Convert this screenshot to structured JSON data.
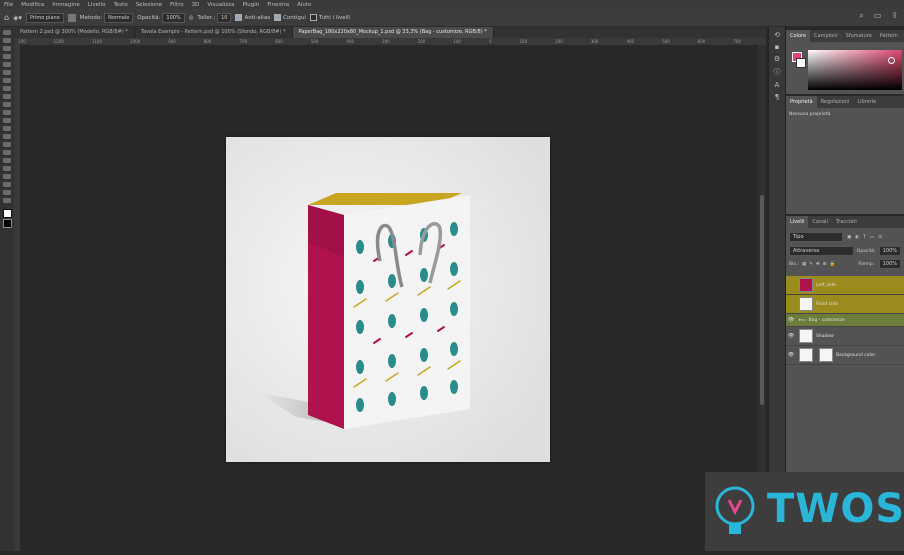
{
  "menu": [
    "File",
    "Modifica",
    "Immagine",
    "Livello",
    "Testo",
    "Selezione",
    "Filtro",
    "3D",
    "Visualizza",
    "Plugin",
    "Finestra",
    "Aiuto"
  ],
  "options": {
    "mode_select": "Primo piano",
    "metodo_label": "Metodo:",
    "metodo_value": "Normale",
    "opacita_label": "Opacità:",
    "opacita_value": "100%",
    "tolleranza_label": "Toller.:",
    "tolleranza_value": "10",
    "antialias": "Anti-alias",
    "contigui": "Contigui",
    "tutti_livelli": "Tutti i livelli"
  },
  "tabs": [
    {
      "label": "Pattern 2.psd @ 300% (Modello, RGB/8#) *",
      "active": false
    },
    {
      "label": "Tavola Esempio - Pattern.psd @ 100% (Sfondo, RGB/8#) *",
      "active": false
    },
    {
      "label": "PaperBag_180x220x80_Mockup_1.psd @ 33,3% (Bag - customize, RGB/8) *",
      "active": true
    }
  ],
  "ruler_ticks": [
    "100",
    "1200",
    "1100",
    "1000",
    "900",
    "800",
    "700",
    "600",
    "500",
    "400",
    "300",
    "200",
    "100",
    "0",
    "100",
    "200",
    "300",
    "400",
    "500",
    "600",
    "700",
    "800",
    "900",
    "1000",
    "1100",
    "1200",
    "1300",
    "1400",
    "1500",
    "1600",
    "1700",
    "1800",
    "1900",
    "2000",
    "2100",
    "2200",
    "2300"
  ],
  "color_panel": {
    "tabs": [
      "Colore",
      "Campioni",
      "Sfumature",
      "Pattern"
    ],
    "foreground": "#e0466f"
  },
  "properties_panel": {
    "tabs": [
      "Proprietà",
      "Regolazioni",
      "Librerie"
    ],
    "content": "Nessuna proprietà"
  },
  "layers_panel": {
    "tabs": [
      "Livelli",
      "Canali",
      "Tracciati"
    ],
    "filter": "Tipo",
    "blend_mode": "Attraversa",
    "opacity_label": "Opacità:",
    "opacity_value": "100%",
    "lock_label": "Blo.:",
    "fill_label": "Riemp.:",
    "fill_value": "100%",
    "layers": [
      {
        "name": "Left_side",
        "color": "#9b8a1c",
        "visible": false
      },
      {
        "name": "Front side",
        "color": "#9b8a1c",
        "visible": false
      },
      {
        "name": "Bag - customize",
        "color": "#6b7d3a",
        "visible": true,
        "group": true
      },
      {
        "name": "Shadow",
        "color": "#535353",
        "visible": true
      },
      {
        "name": "Background color",
        "color": "#535353",
        "visible": true
      }
    ]
  },
  "watermark": {
    "text": "TWOS"
  },
  "colors": {
    "bag_side": "#b0124e",
    "bag_inside": "#c8a520",
    "pattern_teal": "#2a8c8c"
  }
}
